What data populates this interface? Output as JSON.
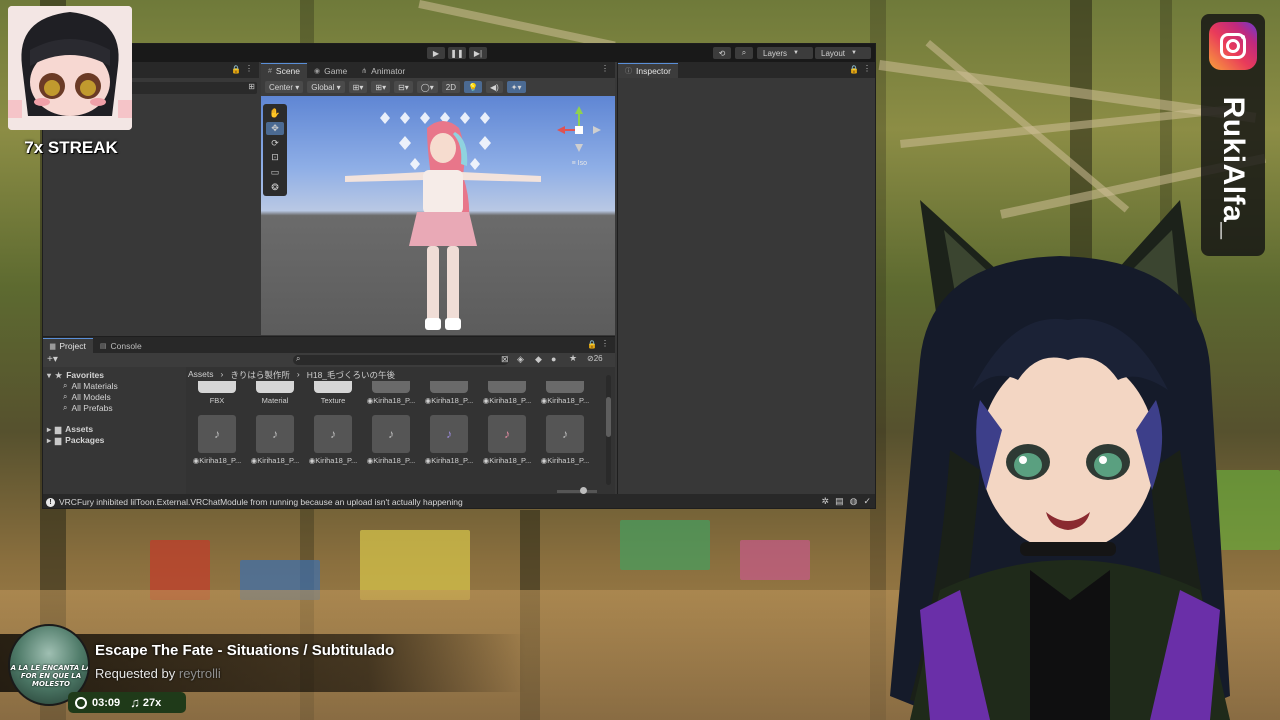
{
  "editor": {
    "toolbar": {
      "layers_label": "Layers",
      "layout_label": "Layout"
    },
    "scene": {
      "tabs": [
        {
          "label": "Scene",
          "icon": "scene-icon"
        },
        {
          "label": "Game",
          "icon": "game-icon"
        },
        {
          "label": "Animator",
          "icon": "animator-icon"
        }
      ],
      "pivot_label": "Center",
      "space_label": "Global",
      "mode_2d_label": "2D",
      "iso_label": "≡ Iso"
    },
    "inspector": {
      "tab_label": "Inspector"
    },
    "project": {
      "tabs": [
        {
          "label": "Project",
          "icon": "folder-icon"
        },
        {
          "label": "Console",
          "icon": "console-icon"
        }
      ],
      "hidden_count": "26",
      "favorites": {
        "label": "Favorites",
        "items": [
          "All Materials",
          "All Models",
          "All Prefabs"
        ]
      },
      "roots": [
        "Assets",
        "Packages"
      ],
      "breadcrumb": [
        "Assets",
        "›",
        "きりはら製作所",
        "›",
        "H18_毛づくろいの午後"
      ],
      "row1": [
        {
          "label": "FBX",
          "kind": "folder"
        },
        {
          "label": "Material",
          "kind": "folder"
        },
        {
          "label": "Texture",
          "kind": "folder"
        },
        {
          "label": "◉Kiriha18_P...",
          "kind": "anim"
        },
        {
          "label": "◉Kiriha18_P...",
          "kind": "anim"
        },
        {
          "label": "◉Kiriha18_P...",
          "kind": "anim"
        },
        {
          "label": "◉Kiriha18_P...",
          "kind": "anim"
        }
      ],
      "row2": [
        {
          "label": "◉Kiriha18_P...",
          "kind": "anim"
        },
        {
          "label": "◉Kiriha18_P...",
          "kind": "anim"
        },
        {
          "label": "◉Kiriha18_P...",
          "kind": "anim"
        },
        {
          "label": "◉Kiriha18_P...",
          "kind": "anim"
        },
        {
          "label": "◉Kiriha18_P...",
          "kind": "anim"
        },
        {
          "label": "◉Kiriha18_P...",
          "kind": "anim"
        },
        {
          "label": "◉Kiriha18_P...",
          "kind": "anim"
        }
      ]
    },
    "status_message": "VRCFury inhibited lilToon.External.VRChatModule from running because an upload isn't actually happening"
  },
  "overlay": {
    "streak_label": "7x STREAK",
    "social_handle": "RukiAlfa_",
    "now_playing": {
      "art_caption": "A LA LE ENCANTA LA FOR EN QUE LA MOLESTO",
      "title": "Escape The Fate - Situations / Subtitulado",
      "requested_prefix": "Requested by",
      "requested_user": "reytrolli",
      "time": "03:09",
      "count": "27x"
    }
  },
  "colors": {
    "unity_bg": "#383838",
    "unity_dark": "#191919",
    "accent_blue": "#4b6a92",
    "pill_green": "#1f3a19"
  }
}
